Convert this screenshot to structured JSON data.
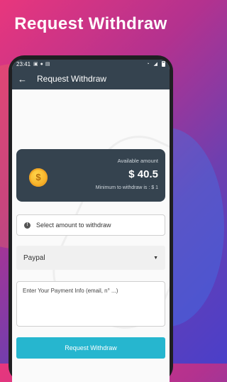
{
  "promo": {
    "title": "Request Withdraw"
  },
  "status_bar": {
    "time": "23:41"
  },
  "app_bar": {
    "title": "Request Withdraw"
  },
  "balance": {
    "available_label": "Available amount",
    "amount": "$ 40.5",
    "minimum_label": "Minimum to withdraw is : $ 1",
    "coin_symbol": "$"
  },
  "amount_select": {
    "label": "Select amount to withdraw"
  },
  "method_select": {
    "value": "Paypal"
  },
  "payment_info": {
    "placeholder": "Enter Your Payment Info (email, n° ...)"
  },
  "submit": {
    "label": "Request Withdraw"
  },
  "colors": {
    "accent": "#26b6cf",
    "toolbar": "#35434f",
    "coin": "#f7b32b"
  }
}
